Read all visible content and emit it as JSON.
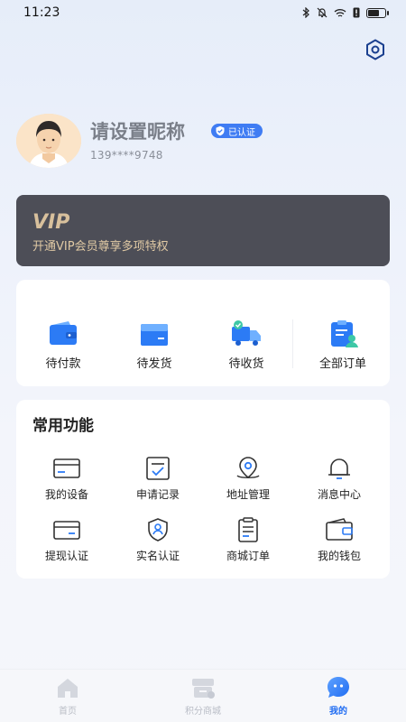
{
  "status_bar": {
    "time": "11:23"
  },
  "profile": {
    "nickname": "请设置昵称",
    "verified_badge": "已认证",
    "phone": "139****9748"
  },
  "vip": {
    "logo": "VIP",
    "subtitle": "开通VIP会员尊享多项特权"
  },
  "orders": [
    {
      "label": "待付款",
      "icon": "wallet-icon"
    },
    {
      "label": "待发货",
      "icon": "box-icon"
    },
    {
      "label": "待收货",
      "icon": "truck-icon"
    },
    {
      "label": "全部订单",
      "icon": "orders-list-icon"
    }
  ],
  "functions": {
    "title": "常用功能",
    "items": [
      {
        "label": "我的设备",
        "icon": "device-icon"
      },
      {
        "label": "申请记录",
        "icon": "record-icon"
      },
      {
        "label": "地址管理",
        "icon": "location-icon"
      },
      {
        "label": "消息中心",
        "icon": "bell-icon"
      },
      {
        "label": "提现认证",
        "icon": "card-icon"
      },
      {
        "label": "实名认证",
        "icon": "shield-user-icon"
      },
      {
        "label": "商城订单",
        "icon": "clipboard-icon"
      },
      {
        "label": "我的钱包",
        "icon": "wallet-outline-icon"
      }
    ]
  },
  "tabbar": [
    {
      "label": "首页",
      "icon": "home-icon",
      "active": false
    },
    {
      "label": "积分商城",
      "icon": "points-mall-icon",
      "active": false
    },
    {
      "label": "我的",
      "icon": "mine-icon",
      "active": true
    }
  ],
  "colors": {
    "accent": "#1f6cf2",
    "vip_card": "#4d4e57",
    "vip_gold": "#e0c9a4",
    "badge": "#3f7cf3"
  }
}
